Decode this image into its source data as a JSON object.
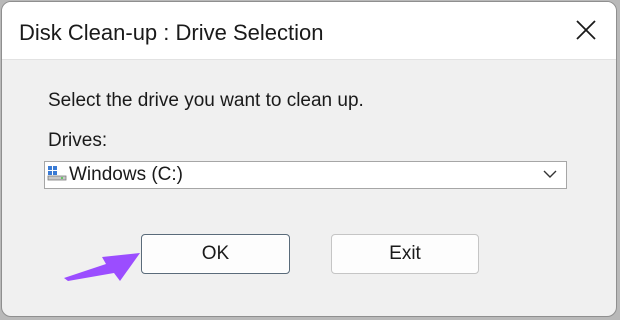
{
  "window": {
    "title": "Disk Clean-up : Drive Selection"
  },
  "main": {
    "instruction": "Select the drive you want to clean up.",
    "drives_label": "Drives:",
    "selected_drive": "Windows (C:)"
  },
  "buttons": {
    "ok_label": "OK",
    "exit_label": "Exit"
  },
  "icons": {
    "close": "close-icon",
    "drive": "drive-icon",
    "dropdown": "chevron-down-icon",
    "annotation": "arrow-pointer-icon"
  },
  "colors": {
    "annotation_arrow": "#9b4dff",
    "window_background": "#f0f0f0",
    "titlebar_background": "#ffffff"
  }
}
